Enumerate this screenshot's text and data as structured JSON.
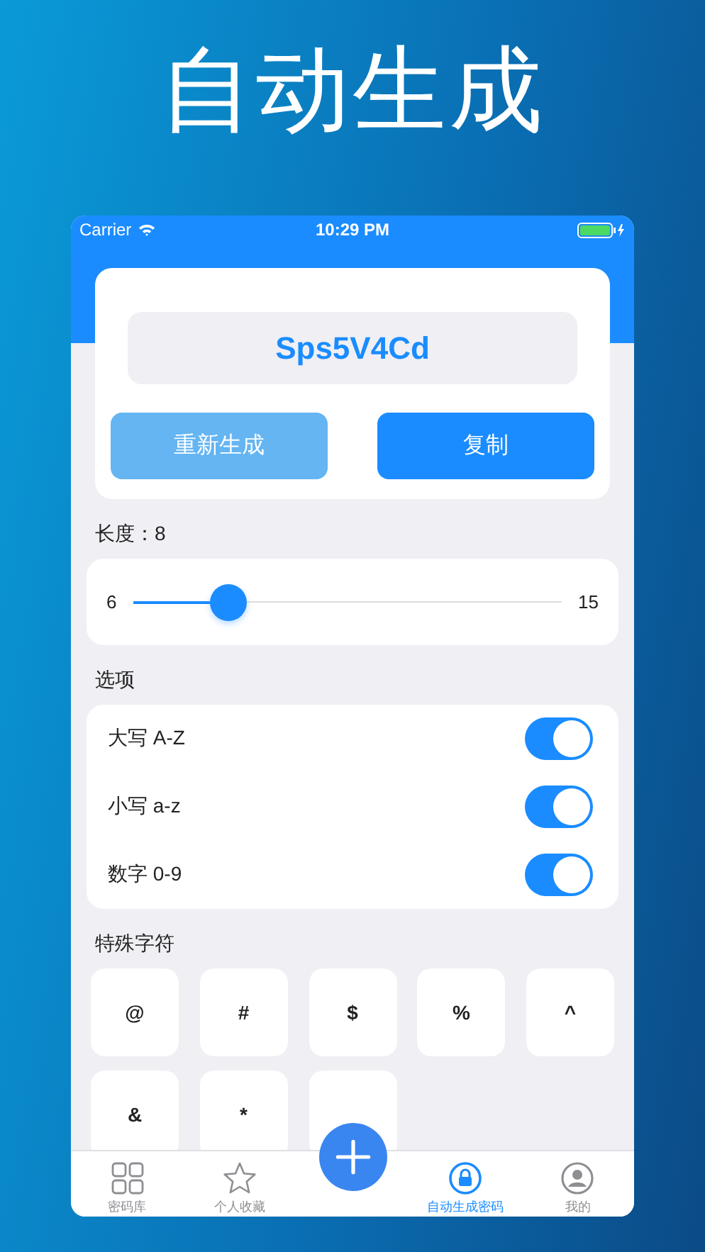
{
  "headline": "自动生成",
  "status_bar": {
    "carrier": "Carrier",
    "time": "10:29 PM"
  },
  "password": "Sps5V4Cd",
  "buttons": [
    {
      "label": "重新生成",
      "kind": "secondary"
    },
    {
      "label": "复制",
      "kind": "primary"
    }
  ],
  "length": {
    "label": "长度：8",
    "min": "6",
    "max": "15",
    "level": 0.22
  },
  "options_title": "选项",
  "options": [
    {
      "label": "大写 A-Z",
      "on": true
    },
    {
      "label": "小写 a-z",
      "on": true
    },
    {
      "label": "数字 0-9",
      "on": true
    }
  ],
  "special_title": "特殊字符",
  "special_keys": [
    {
      "label": "@"
    },
    {
      "label": "#"
    },
    {
      "label": "$"
    },
    {
      "label": "%"
    },
    {
      "label": "^"
    },
    {
      "label": "&"
    },
    {
      "label": "*"
    },
    {
      "covered": true
    }
  ],
  "tabs": [
    {
      "kind": "grid",
      "label": "密码库",
      "selected": false
    },
    {
      "kind": "star",
      "label": "个人收藏",
      "selected": false
    },
    {
      "kind": "add"
    },
    {
      "kind": "lock",
      "label": "自动生成密码",
      "selected": true
    },
    {
      "kind": "person",
      "label": "我的",
      "selected": false
    }
  ]
}
